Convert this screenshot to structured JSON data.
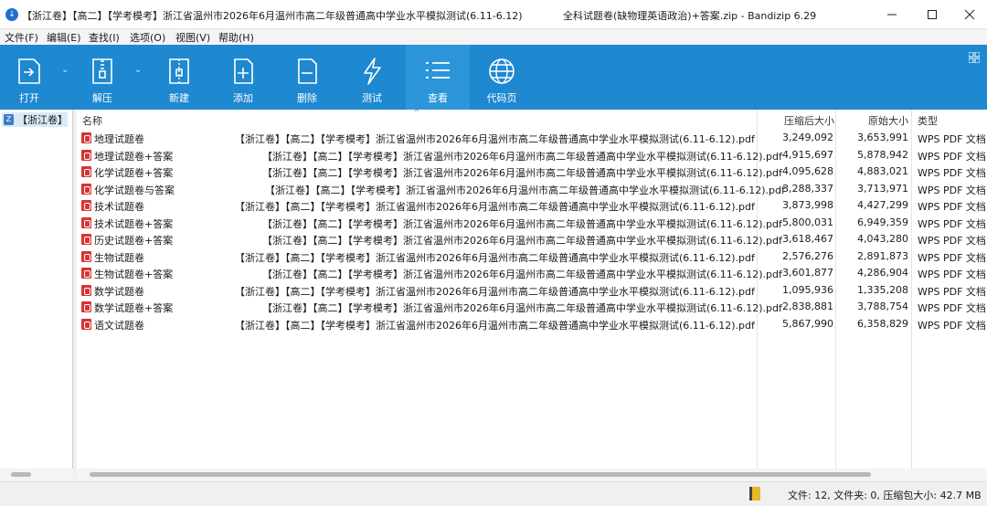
{
  "window": {
    "title_left": "【浙江卷】【高二】【学考模考】浙江省温州市2026年6月温州市高二年级普通高中学业水平模拟测试(6.11-6.12)",
    "title_right": "全科试题卷(缺物理英语政治)+答案.zip - Bandizip 6.29"
  },
  "menu": [
    "文件(F)",
    "编辑(E)",
    "查找(I)",
    "选项(O)",
    "视图(V)",
    "帮助(H)"
  ],
  "toolbar": [
    {
      "label": "打开",
      "icon": "open-icon"
    },
    {
      "label": "解压",
      "icon": "extract-icon"
    },
    {
      "label": "新建",
      "icon": "new-archive-icon"
    },
    {
      "label": "添加",
      "icon": "add-file-icon"
    },
    {
      "label": "删除",
      "icon": "delete-file-icon"
    },
    {
      "label": "测试",
      "icon": "test-icon"
    },
    {
      "label": "查看",
      "icon": "view-icon"
    },
    {
      "label": "代码页",
      "icon": "codepage-icon"
    }
  ],
  "tree": {
    "item": "【浙江卷】"
  },
  "columns": {
    "name": "名称",
    "packed": "压缩后大小",
    "original": "原始大小",
    "type": "类型"
  },
  "files": [
    {
      "name": "地理试题卷",
      "suffix": "【浙江卷】【高二】【学考模考】浙江省温州市2026年6月温州市高二年级普通高中学业水平模拟测试(6.11-6.12).pdf",
      "packed": "3,249,092",
      "original": "3,653,991",
      "type": "WPS PDF 文档"
    },
    {
      "name": "地理试题卷+答案",
      "suffix": "【浙江卷】【高二】【学考模考】浙江省温州市2026年6月温州市高二年级普通高中学业水平模拟测试(6.11-6.12).pdf",
      "packed": "4,915,697",
      "original": "5,878,942",
      "type": "WPS PDF 文档"
    },
    {
      "name": "化学试题卷+答案",
      "suffix": "【浙江卷】【高二】【学考模考】浙江省温州市2026年6月温州市高二年级普通高中学业水平模拟测试(6.11-6.12).pdf",
      "packed": "4,095,628",
      "original": "4,883,021",
      "type": "WPS PDF 文档"
    },
    {
      "name": "化学试题卷与答案",
      "suffix": "【浙江卷】【高二】【学考模考】浙江省温州市2026年6月温州市高二年级普通高中学业水平模拟测试(6.11-6.12).pdf",
      "packed": "3,288,337",
      "original": "3,713,971",
      "type": "WPS PDF 文档"
    },
    {
      "name": "技术试题卷",
      "suffix": "【浙江卷】【高二】【学考模考】浙江省温州市2026年6月温州市高二年级普通高中学业水平模拟测试(6.11-6.12).pdf",
      "packed": "3,873,998",
      "original": "4,427,299",
      "type": "WPS PDF 文档"
    },
    {
      "name": "技术试题卷+答案",
      "suffix": "【浙江卷】【高二】【学考模考】浙江省温州市2026年6月温州市高二年级普通高中学业水平模拟测试(6.11-6.12).pdf",
      "packed": "5,800,031",
      "original": "6,949,359",
      "type": "WPS PDF 文档"
    },
    {
      "name": "历史试题卷+答案",
      "suffix": "【浙江卷】【高二】【学考模考】浙江省温州市2026年6月温州市高二年级普通高中学业水平模拟测试(6.11-6.12).pdf",
      "packed": "3,618,467",
      "original": "4,043,280",
      "type": "WPS PDF 文档"
    },
    {
      "name": "生物试题卷",
      "suffix": "【浙江卷】【高二】【学考模考】浙江省温州市2026年6月温州市高二年级普通高中学业水平模拟测试(6.11-6.12).pdf",
      "packed": "2,576,276",
      "original": "2,891,873",
      "type": "WPS PDF 文档"
    },
    {
      "name": "生物试题卷+答案",
      "suffix": "【浙江卷】【高二】【学考模考】浙江省温州市2026年6月温州市高二年级普通高中学业水平模拟测试(6.11-6.12).pdf",
      "packed": "3,601,877",
      "original": "4,286,904",
      "type": "WPS PDF 文档"
    },
    {
      "name": "数学试题卷",
      "suffix": "【浙江卷】【高二】【学考模考】浙江省温州市2026年6月温州市高二年级普通高中学业水平模拟测试(6.11-6.12).pdf",
      "packed": "1,095,936",
      "original": "1,335,208",
      "type": "WPS PDF 文档"
    },
    {
      "name": "数学试题卷+答案",
      "suffix": "【浙江卷】【高二】【学考模考】浙江省温州市2026年6月温州市高二年级普通高中学业水平模拟测试(6.11-6.12).pdf",
      "packed": "2,838,881",
      "original": "3,788,754",
      "type": "WPS PDF 文档"
    },
    {
      "name": "语文试题卷",
      "suffix": "【浙江卷】【高二】【学考模考】浙江省温州市2026年6月温州市高二年级普通高中学业水平模拟测试(6.11-6.12).pdf",
      "packed": "5,867,990",
      "original": "6,358,829",
      "type": "WPS PDF 文档"
    }
  ],
  "status": "文件: 12, 文件夹: 0, 压缩包大小: 42.7 MB"
}
